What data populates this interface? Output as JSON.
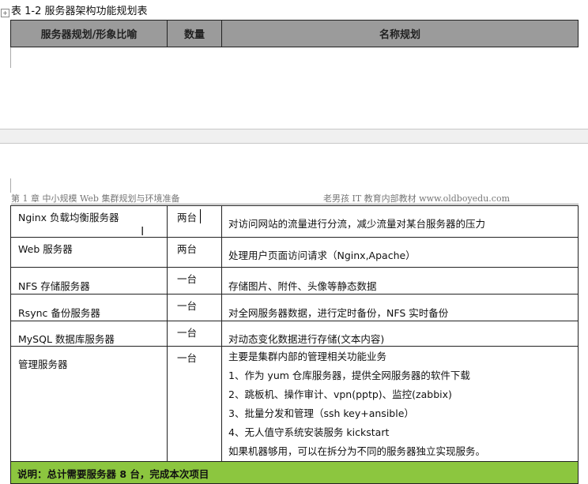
{
  "caption": "表 1-2 服务器架构功能规划表",
  "table_header": {
    "col1": "服务器规划/形象比喻",
    "col2": "数量",
    "col3": "名称规划"
  },
  "page_header": {
    "left": "第 1 章  中小规模 Web 集群规划与环境准备",
    "right": "老男孩 IT 教育内部教材 www.oldboyedu.com"
  },
  "rows": [
    {
      "name": "Nginx 负载均衡服务器",
      "count": "两台",
      "desc": "对访问网站的流量进行分流，减少流量对某台服务器的压力"
    },
    {
      "name": "Web 服务器",
      "count": "两台",
      "desc": "处理用户页面访问请求（Nginx,Apache）"
    },
    {
      "name": "NFS 存储服务器",
      "count": "一台",
      "desc": "存储图片、附件、头像等静态数据"
    },
    {
      "name": "Rsync 备份服务器",
      "count": "一台",
      "desc": "对全网服务器数据，进行定时备份，NFS 实时备份"
    },
    {
      "name": "MySQL 数据库服务器",
      "count": "一台",
      "desc": "对动态变化数据进行存储(文本内容)"
    }
  ],
  "manager": {
    "name": "管理服务器",
    "count": "一台",
    "lines": [
      "主要是集群内部的管理相关功能业务",
      "1、作为 yum 仓库服务器，提供全网服务器的软件下载",
      "2、跳板机、操作审计、vpn(pptp)、监控(zabbix)",
      "3、批量分发和管理（ssh key+ansible）",
      "4、无人值守系统安装服务 kickstart",
      "如果机器够用，可以在拆分为不同的服务器独立实现服务。"
    ]
  },
  "note": "说明：总计需要服务器 8 台，完成本次项目",
  "colors": {
    "header_gray": "#9b9b9b",
    "note_green": "#8cc63f"
  }
}
